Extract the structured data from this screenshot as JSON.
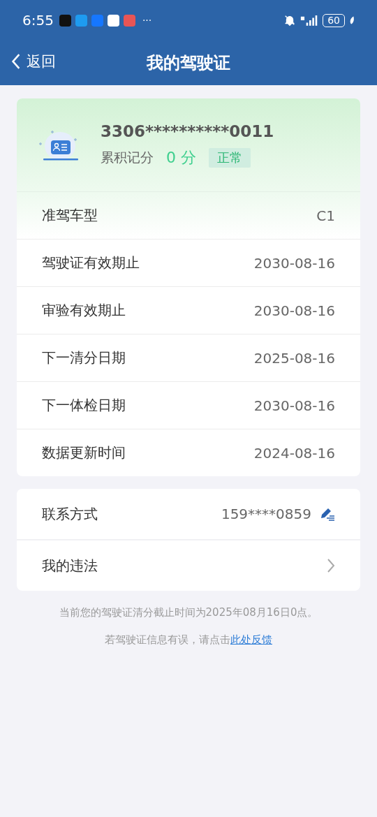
{
  "status_bar": {
    "time": "6:55",
    "more": "···",
    "battery": "60"
  },
  "nav": {
    "back": "返回",
    "title": "我的驾驶证"
  },
  "license": {
    "number": "3306**********0011",
    "points_label": "累积记分",
    "points": "0 分",
    "status": "正常"
  },
  "details": [
    {
      "label": "准驾车型",
      "value": "C1"
    },
    {
      "label": "驾驶证有效期止",
      "value": "2030-08-16"
    },
    {
      "label": "审验有效期止",
      "value": "2030-08-16"
    },
    {
      "label": "下一清分日期",
      "value": "2025-08-16"
    },
    {
      "label": "下一体检日期",
      "value": "2030-08-16"
    },
    {
      "label": "数据更新时间",
      "value": "2024-08-16"
    }
  ],
  "actions": [
    {
      "kind": "edit",
      "label": "联系方式",
      "value": "159****0859"
    },
    {
      "kind": "link",
      "label": "我的违法"
    }
  ],
  "notes": {
    "deadline": "当前您的驾驶证清分截止时间为2025年08月16日0点。",
    "feedback_text": "若驾驶证信息有误，请点击",
    "feedback_link": "此处反馈"
  }
}
